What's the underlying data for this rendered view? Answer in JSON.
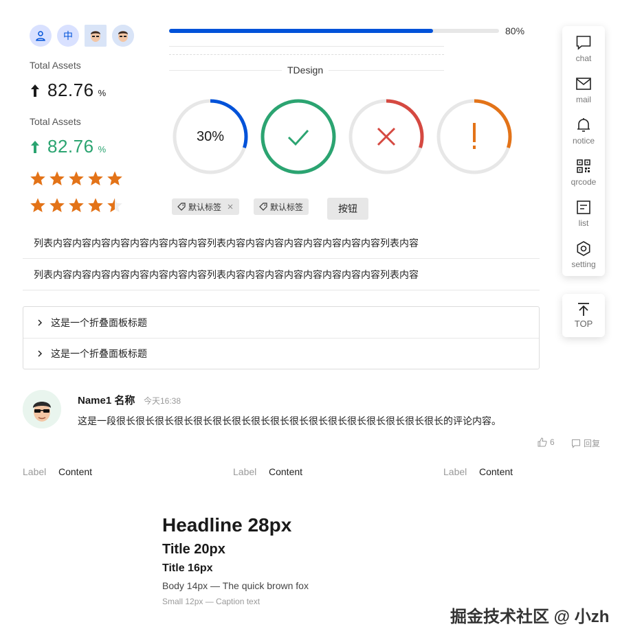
{
  "avatars": [
    {
      "kind": "icon",
      "icon": "user-icon",
      "text": ""
    },
    {
      "kind": "text",
      "text": "中"
    },
    {
      "kind": "image",
      "text": ""
    },
    {
      "kind": "image",
      "text": ""
    }
  ],
  "statistics": [
    {
      "label": "Total Assets",
      "value": "82.76",
      "unit": "%",
      "trend": "up",
      "color": "#1a1a1a"
    },
    {
      "label": "Total Assets",
      "value": "82.76",
      "unit": "%",
      "trend": "up",
      "color": "#2ba471"
    }
  ],
  "rates": [
    {
      "value": 5,
      "max": 5,
      "color": "#e37318"
    },
    {
      "value": 4.5,
      "max": 5,
      "color": "#e37318"
    }
  ],
  "progress": {
    "percent": 80,
    "label": "80%",
    "color": "#0052d9"
  },
  "divider": {
    "text": "TDesign"
  },
  "circles": [
    {
      "percent": 30,
      "label": "30%",
      "status": "default",
      "color": "#0052d9"
    },
    {
      "percent": 100,
      "label": "",
      "status": "success",
      "icon": "check-icon",
      "color": "#2ba471"
    },
    {
      "percent": 30,
      "label": "",
      "status": "error",
      "icon": "close-icon",
      "color": "#d54941"
    },
    {
      "percent": 30,
      "label": "",
      "status": "warning",
      "icon": "exclamation-icon",
      "color": "#e37318"
    }
  ],
  "tags": [
    {
      "label": "默认标签",
      "closable": true
    },
    {
      "label": "默认标签",
      "closable": false
    }
  ],
  "button": {
    "label": "按钮"
  },
  "list": [
    "列表内容内容内容内容内容内容内容内容列表内容内容内容内容内容内容内容内容列表内容",
    "列表内容内容内容内容内容内容内容内容列表内容内容内容内容内容内容内容内容列表内容"
  ],
  "collapse": [
    {
      "title": "这是一个折叠面板标题"
    },
    {
      "title": "这是一个折叠面板标题"
    }
  ],
  "comment": {
    "author": "Name1 名称",
    "time": "今天16:38",
    "content": "这是一段很长很长很长很长很长很长很长很长很长很长很长很长很长很长很长很长很长的评论内容。",
    "likes": "6",
    "reply": "回复"
  },
  "descriptions": [
    {
      "label": "Label",
      "value": "Content"
    },
    {
      "label": "Label",
      "value": "Content"
    },
    {
      "label": "Label",
      "value": "Content"
    }
  ],
  "typography": {
    "headline": "Headline 28px",
    "title20": "Title 20px",
    "title16": "Title 16px",
    "body": "Body 14px — The quick brown fox",
    "small": "Small 12px — Caption text"
  },
  "sticky_tool": [
    {
      "label": "chat",
      "icon": "chat-icon"
    },
    {
      "label": "mail",
      "icon": "mail-icon"
    },
    {
      "label": "notice",
      "icon": "bell-icon"
    },
    {
      "label": "qrcode",
      "icon": "qrcode-icon"
    },
    {
      "label": "list",
      "icon": "list-icon"
    },
    {
      "label": "setting",
      "icon": "setting-icon"
    }
  ],
  "back_top": {
    "label": "TOP",
    "icon": "arrow-up-icon"
  },
  "watermark": "掘金技术社区 @ 小zh"
}
